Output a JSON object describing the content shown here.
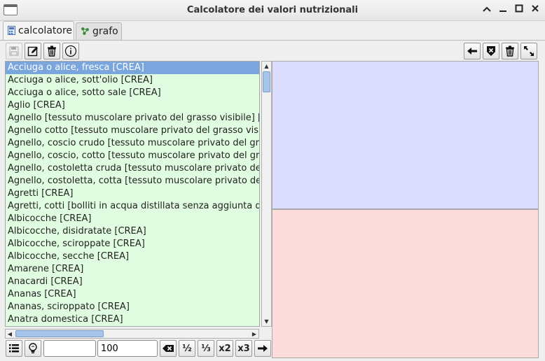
{
  "window": {
    "title": "Calcolatore dei valori nutrizionali",
    "controls": {
      "collapse": "^",
      "minimize": "_",
      "maximize": "□",
      "close": "✕"
    }
  },
  "tabs": [
    {
      "label": "calcolatore",
      "icon": "calculator-icon",
      "active": true
    },
    {
      "label": "grafo",
      "icon": "graph-icon",
      "active": false
    }
  ],
  "toolbar_left": [
    {
      "name": "save-button",
      "icon": "floppy-disk-icon",
      "enabled": false
    },
    {
      "name": "edit-button",
      "icon": "pencil-icon",
      "enabled": true
    },
    {
      "name": "delete-button",
      "icon": "trash-icon",
      "enabled": true
    },
    {
      "name": "info-button",
      "icon": "info-icon",
      "enabled": true
    }
  ],
  "toolbar_right": [
    {
      "name": "back-button",
      "icon": "arrow-left-icon"
    },
    {
      "name": "remove-button",
      "icon": "shield-x-icon"
    },
    {
      "name": "clear-button",
      "icon": "trash-icon"
    },
    {
      "name": "expand-button",
      "icon": "expand-icon"
    }
  ],
  "food_list": {
    "selected_index": 0,
    "items": [
      "Acciuga o alice, fresca [CREA]",
      "Acciuga o alice, sott'olio [CREA]",
      "Acciuga o alice, sotto sale [CREA]",
      "Aglio [CREA]",
      "Agnello [tessuto muscolare privato del grasso visibile] [C",
      "Agnello cotto [tessuto muscolare privato del grasso visib",
      "Agnello, coscio crudo [tessuto muscolare privato del gras",
      "Agnello, coscio, cotto [tessuto muscolare privato del gras",
      "Agnello, costoletta cruda [tessuto muscolare privato del g",
      "Agnello, costoletta, cotta [tessuto muscolare privato del",
      "Agretti [CREA]",
      "Agretti, cotti [bolliti in acqua distillata senza aggiunta di",
      "Albicocche [CREA]",
      "Albicocche, disidratate [CREA]",
      "Albicocche, sciroppate [CREA]",
      "Albicocche, secche [CREA]",
      "Amarene [CREA]",
      "Anacardi [CREA]",
      "Ananas [CREA]",
      "Ananas, sciroppato [CREA]",
      "Anatra domestica [CREA]"
    ]
  },
  "bottom_bar": {
    "search_value": "",
    "quantity_value": "100",
    "buttons": [
      {
        "name": "list-button",
        "label": "",
        "icon": "list-icon"
      },
      {
        "name": "hint-button",
        "label": "",
        "icon": "lightbulb-icon"
      },
      {
        "name": "clear-input-button",
        "label": "",
        "icon": "backspace-icon"
      },
      {
        "name": "half-button",
        "label": "½"
      },
      {
        "name": "third-button",
        "label": "⅓"
      },
      {
        "name": "double-button",
        "label": "x2"
      },
      {
        "name": "triple-button",
        "label": "x3"
      },
      {
        "name": "add-button",
        "label": "",
        "icon": "arrow-right-icon"
      }
    ]
  },
  "colors": {
    "list_background": "#e1fde1",
    "selection": "#7aa5dd",
    "top_panel": "#dcdcfe",
    "bottom_panel": "#fddcdc"
  }
}
